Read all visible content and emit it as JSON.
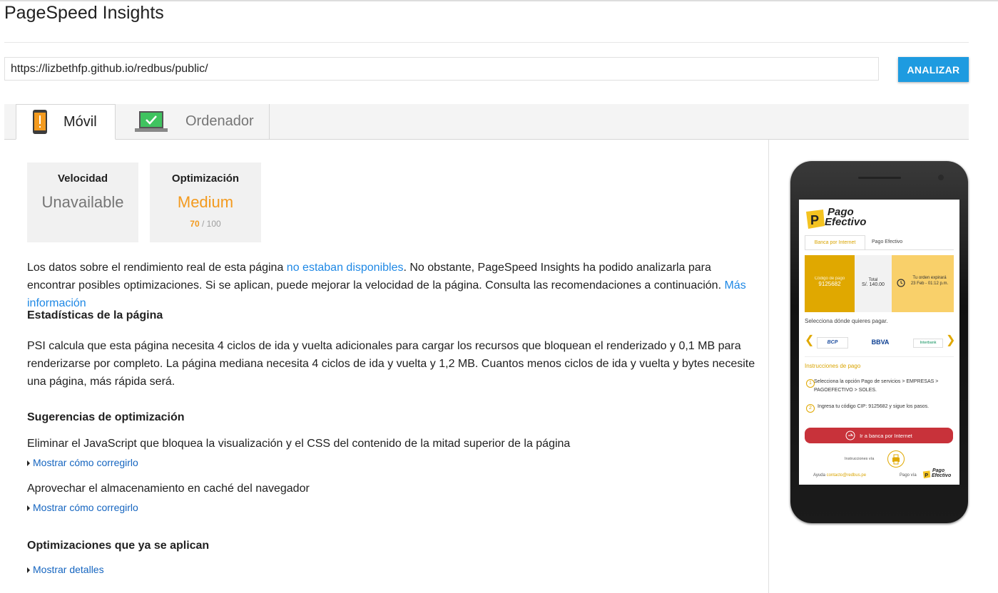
{
  "header": {
    "title": "PageSpeed Insights"
  },
  "search": {
    "url": "https://lizbethfp.github.io/redbus/public/",
    "analyze_label": "ANALIZAR"
  },
  "tabs": {
    "mobile": "Móvil",
    "desktop": "Ordenador"
  },
  "scores": {
    "speed": {
      "label": "Velocidad",
      "value": "Unavailable"
    },
    "optimization": {
      "label": "Optimización",
      "value": "Medium",
      "score": "70",
      "max": "/ 100"
    }
  },
  "intro": {
    "part1": "Los datos sobre el rendimiento real de esta página ",
    "link1": "no estaban disponibles",
    "part2": ". No obstante, PageSpeed Insights ha podido analizarla para encontrar posibles optimizaciones. Si se aplican, puede mejorar la velocidad de la página. Consulta las recomendaciones a continuación. ",
    "link2": "Más información"
  },
  "stats": {
    "heading": "Estadísticas de la página",
    "text": "PSI calcula que esta página necesita 4 ciclos de ida y vuelta adicionales para cargar los recursos que bloquean el renderizado y 0,1 MB para renderizarse por completo. La página mediana necesita 4 ciclos de ida y vuelta y 1,2 MB. Cuantos menos ciclos de ida y vuelta y bytes necesite una página, más rápida será."
  },
  "suggestions": {
    "heading": "Sugerencias de optimización",
    "items": [
      {
        "text": "Eliminar el JavaScript que bloquea la visualización y el CSS del contenido de la mitad superior de la página",
        "toggle": "Mostrar cómo corregirlo"
      },
      {
        "text": "Aprovechar el almacenamiento en caché del navegador",
        "toggle": "Mostrar cómo corregirlo"
      }
    ]
  },
  "applied": {
    "heading": "Optimizaciones que ya se aplican",
    "toggle": "Mostrar detalles"
  },
  "preview": {
    "logo_line1": "Pago",
    "logo_line2": "Efectivo",
    "tab1": "Banca por Internet",
    "tab2": "Pago Efectivo",
    "code_label": "Código de pago",
    "code_value": "9125682",
    "total_label": "Total",
    "total_value": "S/. 140.00",
    "expiry_label": "Tu orden expirará",
    "expiry_value": "23 Feb - 01:12 p.m.",
    "select_text": "Selecciona dónde quieres pagar.",
    "banks": [
      "BCP",
      "BBVA",
      "Interbank"
    ],
    "instructions_title": "Instrucciones de pago",
    "step1": "Selecciona la opción Pago de servicios > EMPRESAS > PAGOEFECTIVO > SOLES.",
    "step2": "Ingresa tu código CIP: 9125682 y sigue los pasos.",
    "bank_button": "Ir a banca por Internet",
    "instructions_via": "Instrucciones vía",
    "help_label": "Ayuda",
    "help_email": "contacto@redbus.pe",
    "pay_via": "Pago vía"
  }
}
